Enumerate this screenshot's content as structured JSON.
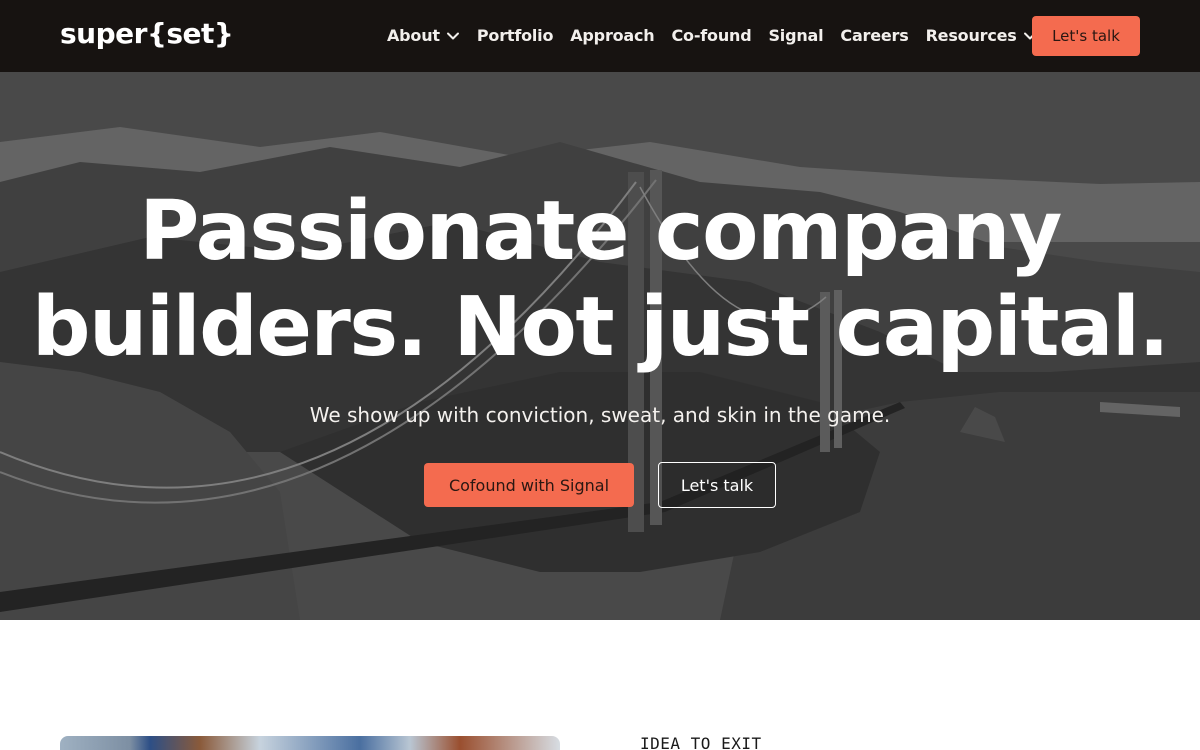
{
  "nav": {
    "logo": "super{set}",
    "items": [
      {
        "label": "About",
        "dropdown": true
      },
      {
        "label": "Portfolio",
        "dropdown": false
      },
      {
        "label": "Approach",
        "dropdown": false
      },
      {
        "label": "Co-found",
        "dropdown": false
      },
      {
        "label": "Signal",
        "dropdown": false
      },
      {
        "label": "Careers",
        "dropdown": false
      },
      {
        "label": "Resources",
        "dropdown": true
      }
    ],
    "cta_label": "Let's talk"
  },
  "hero": {
    "title_line1": "Passionate company",
    "title_line2": "builders. Not just capital.",
    "subtitle": "We show up with conviction, sweat, and skin in the game.",
    "primary_button": "Cofound with Signal",
    "secondary_button": "Let's talk",
    "background": "aerial-bridge-photo"
  },
  "section": {
    "eyebrow": "IDEA TO EXIT"
  },
  "colors": {
    "nav_bg": "#171311",
    "accent": "#f46b4f",
    "text_light": "#ffffff"
  }
}
